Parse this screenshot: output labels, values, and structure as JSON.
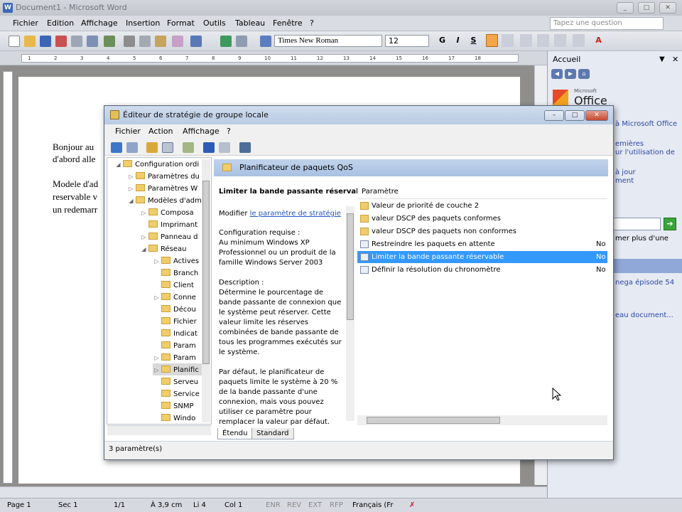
{
  "word": {
    "title": "Document1 - Microsoft Word",
    "menu": [
      "Fichier",
      "Edition",
      "Affichage",
      "Insertion",
      "Format",
      "Outils",
      "Tableau",
      "Fenêtre",
      "?"
    ],
    "ask_placeholder": "Tapez une question",
    "font": "Times New Roman",
    "size": "12",
    "format_buttons": [
      "G",
      "I",
      "S"
    ],
    "ruler_ticks": [
      "1",
      "2",
      "3",
      "4",
      "5",
      "6",
      "7",
      "8",
      "9",
      "10",
      "11",
      "12",
      "13",
      "14",
      "15",
      "16",
      "17",
      "18"
    ],
    "doc_lines": [
      "Bonjour au",
      "d'abord alle",
      "Modele d'ad",
      "reservable v",
      "un redemarr"
    ],
    "status": {
      "page": "Page 1",
      "sec": "Sec 1",
      "pages": "1/1",
      "pos": "À 3,9 cm",
      "line": "Li 4",
      "col": "Col 1",
      "modes": [
        "ENR",
        "REV",
        "EXT",
        "RFP"
      ],
      "lang": "Français (Fr"
    }
  },
  "pane": {
    "title": "Accueil",
    "logo": "Office Online",
    "logo_small": "Microsoft",
    "links": [
      "à Microsoft Office",
      "emières",
      "ur l'utilisation de",
      "à jour",
      "ment",
      "mer plus d'une",
      "nega épisode 54",
      "eau document..."
    ]
  },
  "dialog": {
    "title": "Éditeur de stratégie de groupe locale",
    "menu": [
      "Fichier",
      "Action",
      "Affichage",
      "?"
    ],
    "tree": [
      {
        "label": "Configuration ordi",
        "level": 0,
        "exp": "◢"
      },
      {
        "label": "Paramètres du",
        "level": 1,
        "exp": "▷"
      },
      {
        "label": "Paramètres W",
        "level": 1,
        "exp": "▷"
      },
      {
        "label": "Modèles d'adm",
        "level": 1,
        "exp": "◢"
      },
      {
        "label": "Composa",
        "level": 2,
        "exp": "▷"
      },
      {
        "label": "Imprimant",
        "level": 2,
        "exp": ""
      },
      {
        "label": "Panneau d",
        "level": 2,
        "exp": "▷"
      },
      {
        "label": "Réseau",
        "level": 2,
        "exp": "◢"
      },
      {
        "label": "Actives",
        "level": 3,
        "exp": "▷"
      },
      {
        "label": "Branch",
        "level": 3,
        "exp": ""
      },
      {
        "label": "Client",
        "level": 3,
        "exp": ""
      },
      {
        "label": "Conne",
        "level": 3,
        "exp": "▷"
      },
      {
        "label": "Décou",
        "level": 3,
        "exp": ""
      },
      {
        "label": "Fichier",
        "level": 3,
        "exp": ""
      },
      {
        "label": "Indicat",
        "level": 3,
        "exp": ""
      },
      {
        "label": "Param",
        "level": 3,
        "exp": ""
      },
      {
        "label": "Param",
        "level": 3,
        "exp": "▷"
      },
      {
        "label": "Planific",
        "level": 3,
        "exp": "▷"
      },
      {
        "label": "Serveu",
        "level": 3,
        "exp": ""
      },
      {
        "label": "Service",
        "level": 3,
        "exp": ""
      },
      {
        "label": "SNMP",
        "level": 3,
        "exp": ""
      },
      {
        "label": "Windo",
        "level": 3,
        "exp": ""
      }
    ],
    "header": "Planificateur de paquets QoS",
    "ext_title": "Limiter la bande passante réservable",
    "ext_modify": "Modifier",
    "ext_link": "le paramètre de stratégie",
    "ext_req": [
      "Configuration requise :",
      "Au minimum Windows XP",
      "Professionnel ou un produit de la",
      "famille Windows Server 2003"
    ],
    "ext_desc": [
      "Description :",
      "Détermine le pourcentage de",
      "bande passante de connexion que",
      "le système peut réserver. Cette",
      "valeur limite les réserves",
      "combinées de bande passante de",
      "tous les programmes exécutés sur",
      "le système."
    ],
    "ext_default": [
      "Par défaut, le planificateur de",
      "paquets limite le système à 20 %",
      "de la bande passante d'une",
      "connexion, mais vous pouvez",
      "utiliser ce paramètre pour",
      "remplacer la valeur par défaut."
    ],
    "list_col": "Paramètre",
    "items": [
      {
        "label": "Valeur de priorité de couche 2",
        "kind": "folder",
        "state": ""
      },
      {
        "label": "valeur DSCP des paquets conformes",
        "kind": "folder",
        "state": ""
      },
      {
        "label": "valeur DSCP des paquets non conformes",
        "kind": "folder",
        "state": ""
      },
      {
        "label": "Restreindre les paquets en attente",
        "kind": "setting",
        "state": "No"
      },
      {
        "label": "Limiter la bande passante réservable",
        "kind": "setting",
        "state": "No",
        "selected": true
      },
      {
        "label": "Définir la résolution du chronomètre",
        "kind": "setting",
        "state": "No"
      }
    ],
    "tabs": [
      "Étendu",
      "Standard"
    ],
    "status": "3 paramètre(s)"
  }
}
